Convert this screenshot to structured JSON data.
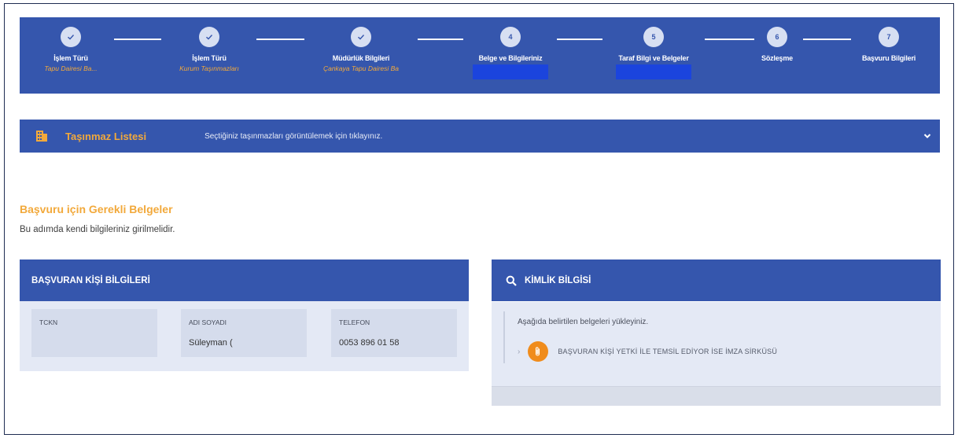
{
  "stepper": {
    "steps": [
      {
        "title": "İşlem Türü",
        "subtitle": "Tapu Dairesi Ba...",
        "status": "done"
      },
      {
        "title": "İşlem Türü",
        "subtitle": "Kurum Taşınmazları",
        "status": "done"
      },
      {
        "title": "Müdürlük Bilgileri",
        "subtitle": "Çankaya Tapu Dairesi Ba",
        "status": "done"
      },
      {
        "title": "Belge ve Bilgileriniz",
        "number": "4",
        "status": "current"
      },
      {
        "title": "Taraf Bilgi ve Belgeler",
        "number": "5",
        "status": "pending"
      },
      {
        "title": "Sözleşme",
        "number": "6",
        "status": "pending"
      },
      {
        "title": "Başvuru Bilgileri",
        "number": "7",
        "status": "pending"
      }
    ]
  },
  "tasinmaz": {
    "title": "Taşınmaz Listesi",
    "hint": "Seçtiğiniz taşınmazları görüntülemek için tıklayınız."
  },
  "requirements": {
    "title": "Başvuru için Gerekli Belgeler",
    "description": "Bu adımda kendi bilgileriniz girilmelidir."
  },
  "applicant": {
    "heading": "BAŞVURAN KİŞİ BİLGİLERİ",
    "fields": [
      {
        "label": "TCKN",
        "value": ""
      },
      {
        "label": "ADI SOYADI",
        "value": "Süleyman ("
      },
      {
        "label": "TELEFON",
        "value": "0053 896 01 58"
      }
    ]
  },
  "identity": {
    "heading": "KİMLİK BİLGİSİ",
    "intro": "Aşağıda belirtilen belgeleri yükleyiniz.",
    "documents": [
      {
        "label": "BAŞVURAN KİŞİ YETKİ İLE TEMSİL EDİYOR İSE İMZA SİRKÜSÜ"
      }
    ]
  },
  "colors": {
    "primary": "#3556ad",
    "accent": "#f2a93b",
    "redaction": "#1b44dd",
    "panel_bg": "#e4e9f5"
  },
  "icons": {
    "done_step": "check-icon",
    "tasinmaz": "building-icon",
    "expand": "chevron-down-icon",
    "identity": "search-icon",
    "document": "paperclip-icon",
    "doc_expand": "chevron-right-icon"
  }
}
